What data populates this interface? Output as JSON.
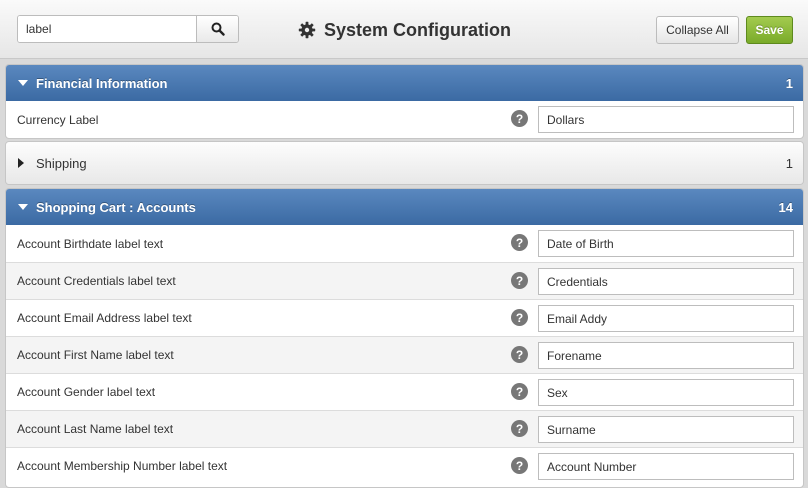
{
  "header": {
    "search_value": "label",
    "search_icon": "search-icon",
    "title": "System Configuration",
    "title_icon": "gear-icon",
    "collapse_label": "Collapse All",
    "save_label": "Save"
  },
  "colors": {
    "panel_header": "#4a79b2",
    "save_button": "#8dbb3c",
    "help_icon": "#777777"
  },
  "panels": [
    {
      "title": "Financial Information",
      "count": "1",
      "expanded": true,
      "rows": [
        {
          "label": "Currency Label",
          "value": "Dollars"
        }
      ]
    },
    {
      "title": "Shipping",
      "count": "1",
      "expanded": false,
      "rows": []
    },
    {
      "title": "Shopping Cart : Accounts",
      "count": "14",
      "expanded": true,
      "rows": [
        {
          "label": "Account Birthdate label text",
          "value": "Date of Birth"
        },
        {
          "label": "Account Credentials label text",
          "value": "Credentials"
        },
        {
          "label": "Account Email Address label text",
          "value": "Email Addy"
        },
        {
          "label": "Account First Name label text",
          "value": "Forename"
        },
        {
          "label": "Account Gender label text",
          "value": "Sex"
        },
        {
          "label": "Account Last Name label text",
          "value": "Surname"
        },
        {
          "label": "Account Membership Number label text",
          "value": "Account Number"
        }
      ]
    }
  ]
}
